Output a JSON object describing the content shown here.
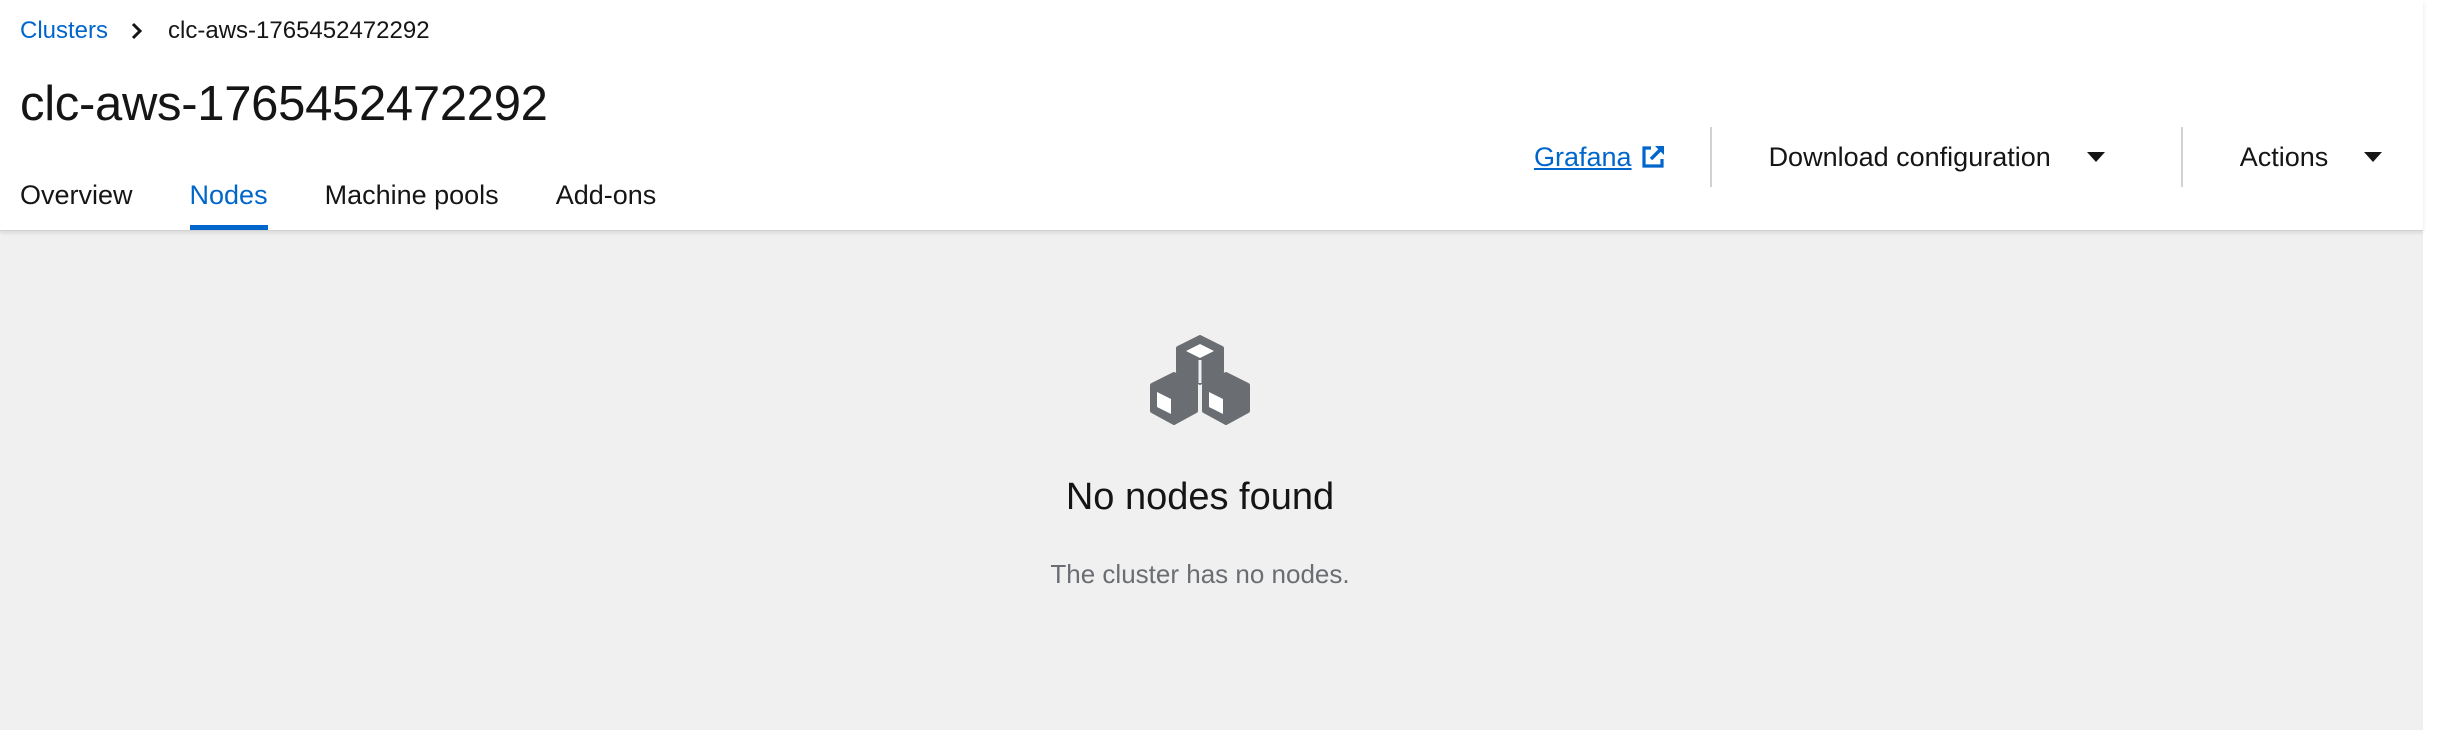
{
  "breadcrumb": {
    "parent_label": "Clusters",
    "current_label": "clc-aws-1765452472292"
  },
  "page_title": "clc-aws-1765452472292",
  "tabs": [
    {
      "label": "Overview",
      "active": false
    },
    {
      "label": "Nodes",
      "active": true
    },
    {
      "label": "Machine pools",
      "active": false
    },
    {
      "label": "Add-ons",
      "active": false
    }
  ],
  "toolbar": {
    "grafana_label": "Grafana",
    "grafana_icon": "external-link-icon",
    "download_label": "Download configuration",
    "actions_label": "Actions"
  },
  "empty_state": {
    "icon": "cubes-icon",
    "title": "No nodes found",
    "body": "The cluster has no nodes."
  },
  "colors": {
    "accent": "#0066cc",
    "text": "#151515",
    "muted_text": "#6a6e73",
    "content_bg": "#f0f0f0",
    "icon_gray": "#6a6e73"
  }
}
